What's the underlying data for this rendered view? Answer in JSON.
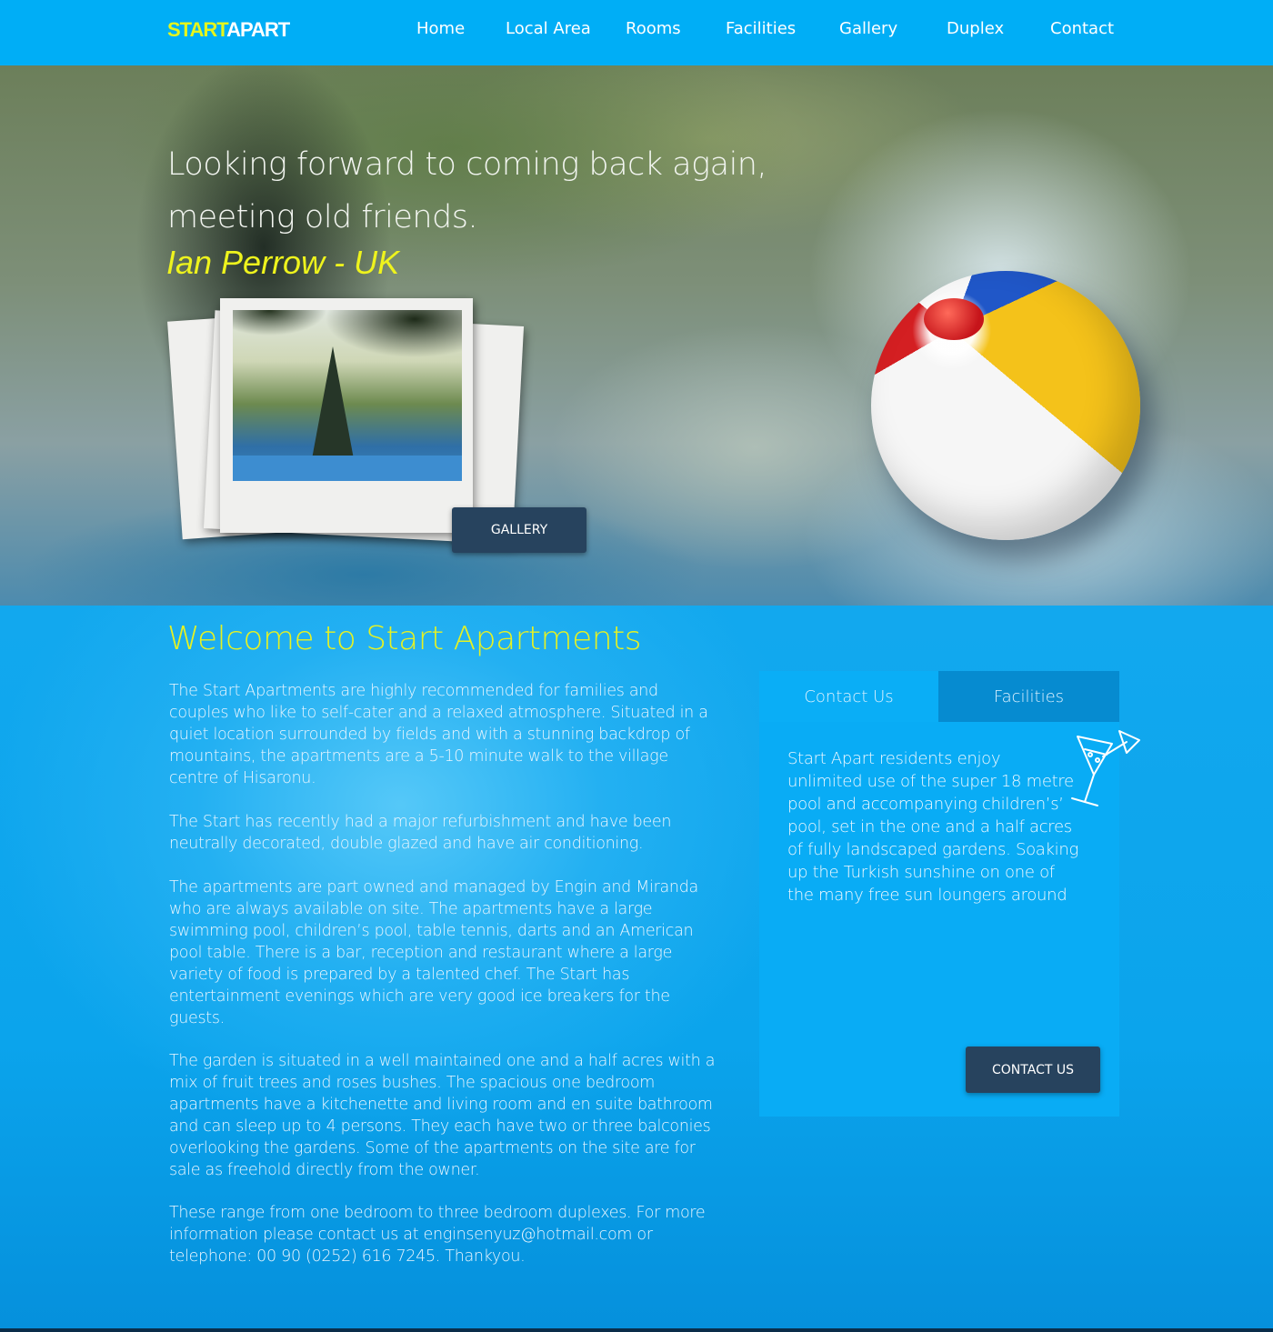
{
  "brand": {
    "part1": "START",
    "part2": "APART"
  },
  "nav": [
    {
      "label": "Home"
    },
    {
      "label": "Local Area"
    },
    {
      "label": "Rooms"
    },
    {
      "label": "Facilities"
    },
    {
      "label": "Gallery"
    },
    {
      "label": "Duplex"
    },
    {
      "label": "Contact"
    }
  ],
  "hero": {
    "quote_line1": "Looking forward to coming back again,",
    "quote_line2": "meeting old friends.",
    "author": "Ian Perrow - UK",
    "gallery_button": "GALLERY"
  },
  "welcome": {
    "title": "Welcome to Start Apartments",
    "paragraphs": [
      "The Start Apartments are highly recommended for families and couples who like to self-cater and a relaxed atmosphere. Situated in a quiet location surrounded by fields and with a stunning backdrop of mountains, the apartments are a 5-10 minute walk to the village centre of Hisaronu.",
      "The Start has recently had a major refurbishment and have been neutrally decorated, double glazed and have air conditioning.",
      "The apartments are part owned and managed by Engin and Miranda who are always available on site. The apartments have a large swimming pool, children’s pool, table tennis, darts and an American pool table. There is a bar, reception and restaurant where a large variety of food is prepared by a talented chef. The Start has entertainment evenings which are very good ice breakers for the guests.",
      "The garden is situated in a well maintained one and a half acres with a mix of fruit trees and roses bushes. The spacious one bedroom apartments have a kitchenette and living room and en suite bathroom and can sleep up to 4 persons. They each have two or three balconies overlooking the gardens. Some of the apartments on the site are for sale as freehold directly from the owner.",
      "These range from one bedroom to three bedroom duplexes. For more information please contact us at enginsenyuz@hotmail.com or telephone: 00 90 (0252) 616 7245. Thankyou."
    ]
  },
  "panel": {
    "tabs": [
      {
        "label": "Contact Us"
      },
      {
        "label": "Facilities"
      }
    ],
    "text": "Start Apart residents enjoy unlimited use of the super 18 metre pool and accompanying children’s’ pool, set in the one and a half acres of fully landscaped gardens. Soaking up the Turkish sunshine on one of the many free sun loungers around",
    "icon": "cocktail-icon",
    "contact_button": "CONTACT US"
  },
  "colors": {
    "nav_bg": "#00aef6",
    "accent_yellow": "#e6f222",
    "button_bg": "#27435e",
    "content_bg": "#0a9ee8"
  }
}
